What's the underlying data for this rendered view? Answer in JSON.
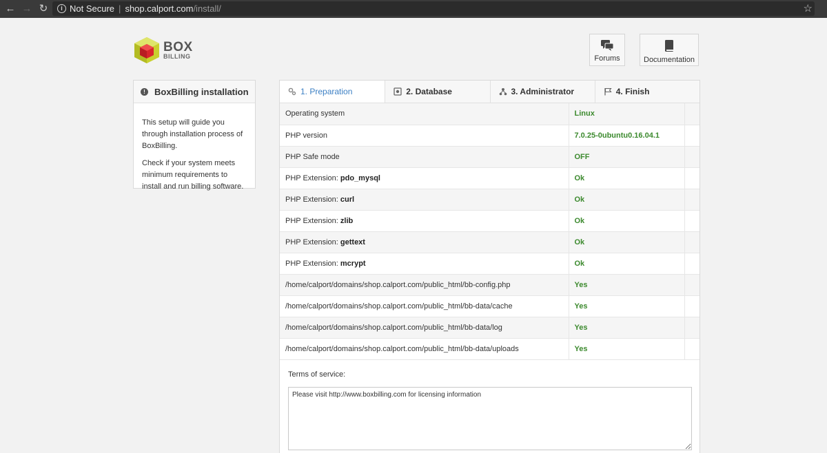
{
  "browser": {
    "security": "Not Secure",
    "url_host": "shop.calport.com",
    "url_path": "/install/"
  },
  "logo": {
    "line1": "BOX",
    "line2": "BILLING"
  },
  "header_buttons": {
    "forums": "Forums",
    "documentation": "Documentation"
  },
  "sidebar": {
    "title": "BoxBilling installation",
    "para1": "This setup will guide you through installation process of BoxBilling.",
    "para2": "Check if your system meets minimum requirements to install and run billing software."
  },
  "tabs": [
    "1. Preparation",
    "2. Database",
    "3. Administrator",
    "4. Finish"
  ],
  "requirements": [
    {
      "label": "Operating system",
      "bold": "",
      "value": "Linux"
    },
    {
      "label": "PHP version",
      "bold": "",
      "value": "7.0.25-0ubuntu0.16.04.1"
    },
    {
      "label": "PHP Safe mode",
      "bold": "",
      "value": "OFF"
    },
    {
      "label": "PHP Extension: ",
      "bold": "pdo_mysql",
      "value": "Ok"
    },
    {
      "label": "PHP Extension: ",
      "bold": "curl",
      "value": "Ok"
    },
    {
      "label": "PHP Extension: ",
      "bold": "zlib",
      "value": "Ok"
    },
    {
      "label": "PHP Extension: ",
      "bold": "gettext",
      "value": "Ok"
    },
    {
      "label": "PHP Extension: ",
      "bold": "mcrypt",
      "value": "Ok"
    },
    {
      "label": "/home/calport/domains/shop.calport.com/public_html/bb-config.php",
      "bold": "",
      "value": "Yes"
    },
    {
      "label": "/home/calport/domains/shop.calport.com/public_html/bb-data/cache",
      "bold": "",
      "value": "Yes"
    },
    {
      "label": "/home/calport/domains/shop.calport.com/public_html/bb-data/log",
      "bold": "",
      "value": "Yes"
    },
    {
      "label": "/home/calport/domains/shop.calport.com/public_html/bb-data/uploads",
      "bold": "",
      "value": "Yes"
    }
  ],
  "terms": {
    "label": "Terms of service:",
    "text": "Please visit http://www.boxbilling.com for licensing information"
  },
  "colors": {
    "ok_green": "#3c8a2e",
    "active_tab": "#3b7fc4",
    "logo_red": "#d9262b",
    "logo_yellow": "#c9d12e"
  }
}
